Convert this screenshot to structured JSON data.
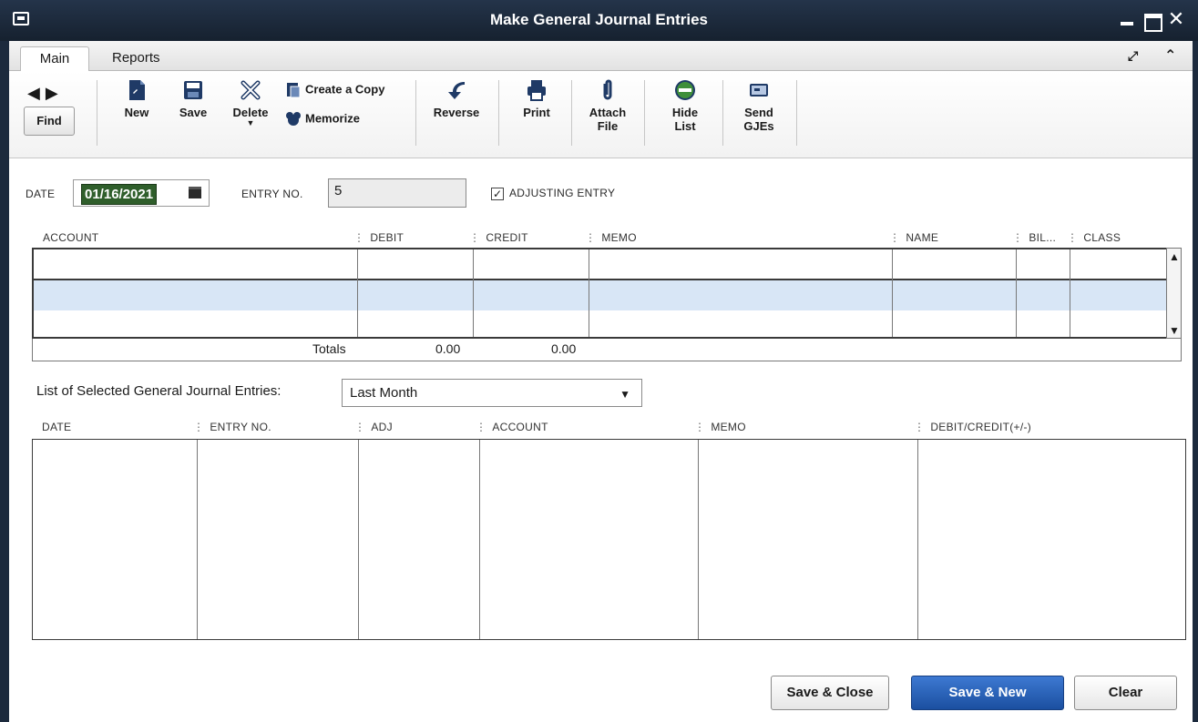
{
  "window": {
    "title": "Make General Journal Entries"
  },
  "tabs": [
    {
      "label": "Main"
    },
    {
      "label": "Reports"
    }
  ],
  "toolbar": {
    "find_label": "Find",
    "new_label": "New",
    "save_label": "Save",
    "delete_label": "Delete",
    "create_copy_label": "Create a Copy",
    "memorize_label": "Memorize",
    "reverse_label": "Reverse",
    "print_label": "Print",
    "attach_label_1": "Attach",
    "attach_label_2": "File",
    "hide_label_1": "Hide",
    "hide_label_2": "List",
    "send_label_1": "Send",
    "send_label_2": "GJEs"
  },
  "form": {
    "date_label": "DATE",
    "date_value": "01/16/2021",
    "entry_no_label": "ENTRY NO.",
    "entry_no_value": "5",
    "adjusting_label": "ADJUSTING ENTRY",
    "adjusting_checked": true
  },
  "entry_grid": {
    "columns": [
      "ACCOUNT",
      "DEBIT",
      "CREDIT",
      "MEMO",
      "NAME",
      "BIL...",
      "CLASS"
    ],
    "totals_label": "Totals",
    "total_debit": "0.00",
    "total_credit": "0.00"
  },
  "list": {
    "label": "List of Selected General Journal Entries:",
    "filter_value": "Last Month",
    "columns": [
      "DATE",
      "ENTRY NO.",
      "ADJ",
      "ACCOUNT",
      "MEMO",
      "DEBIT/CREDIT(+/-)"
    ]
  },
  "buttons": {
    "save_close": "Save & Close",
    "save_new": "Save & New",
    "clear": "Clear"
  },
  "colors": {
    "titlebar": "#1c2a3d",
    "date_highlight": "#2f5e2b",
    "selected_row": "#d8e6f6",
    "primary_button": "#2a62b8"
  }
}
